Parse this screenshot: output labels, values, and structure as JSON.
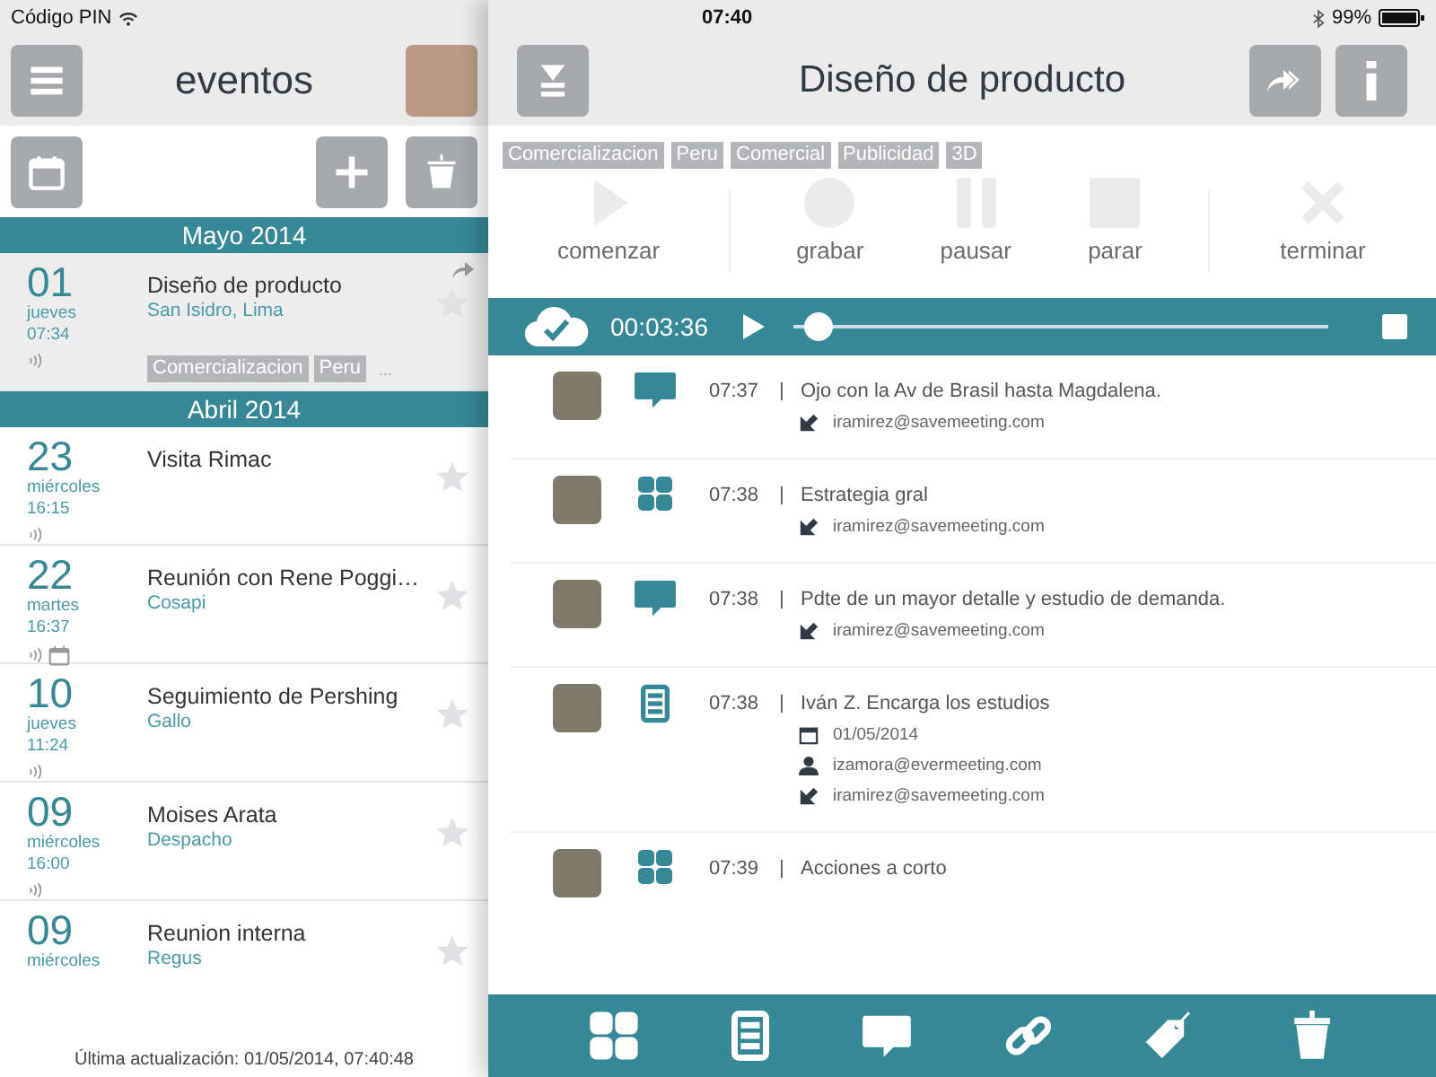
{
  "status_bar": {
    "carrier": "Código PIN",
    "time": "07:40",
    "battery": "99%"
  },
  "sidebar": {
    "title": "eventos",
    "sections": [
      {
        "month": "Mayo 2014",
        "events": [
          {
            "day": "01",
            "weekday": "jueves",
            "time": "07:34",
            "title": "Diseño de producto",
            "place": "San Isidro, Lima",
            "selected": true,
            "audio": true,
            "calendar": false,
            "shared": true,
            "tags": [
              "Comercializacion",
              "Peru"
            ],
            "more": "..."
          }
        ]
      },
      {
        "month": "Abril 2014",
        "events": [
          {
            "day": "23",
            "weekday": "miércoles",
            "time": "16:15",
            "title": "Visita Rimac",
            "selected": false,
            "audio": true,
            "calendar": false,
            "shared": false
          },
          {
            "day": "22",
            "weekday": "martes",
            "time": "16:37",
            "title": "Reunión con Rene Poggi…",
            "place": "Cosapi",
            "selected": false,
            "audio": true,
            "calendar": true,
            "shared": false
          },
          {
            "day": "10",
            "weekday": "jueves",
            "time": "11:24",
            "title": "Seguimiento de Pershing",
            "place": "Gallo",
            "selected": false,
            "audio": true,
            "calendar": false,
            "shared": false
          },
          {
            "day": "09",
            "weekday": "miércoles",
            "time": "16:00",
            "title": "Moises Arata",
            "place": "Despacho",
            "selected": false,
            "audio": true,
            "calendar": false,
            "shared": false
          },
          {
            "day": "09",
            "weekday": "miércoles",
            "title": "Reunion interna",
            "place": "Regus",
            "selected": false,
            "audio": false,
            "calendar": false,
            "shared": false
          }
        ]
      }
    ],
    "footer": "Última actualización: 01/05/2014, 07:40:48"
  },
  "detail": {
    "title": "Diseño de producto",
    "tags": [
      "Comercializacion",
      "Peru",
      "Comercial",
      "Publicidad",
      "3D"
    ],
    "control_groups": [
      [
        {
          "label": "comenzar",
          "kind": "play",
          "disabled": true
        }
      ],
      [
        {
          "label": "grabar",
          "kind": "record",
          "disabled": true
        },
        {
          "label": "pausar",
          "kind": "pause",
          "disabled": true
        },
        {
          "label": "parar",
          "kind": "stop",
          "disabled": true
        }
      ],
      [
        {
          "label": "terminar",
          "kind": "end",
          "disabled": true
        }
      ]
    ],
    "player": {
      "elapsed": "00:03:36",
      "level": 0.02
    },
    "entries": [
      {
        "kind": "comment",
        "time": "07:37",
        "text": "Ojo con la Av de Brasil hasta Magdalena.",
        "meta": [
          {
            "kind": "assignee",
            "text": "iramirez@savemeeting.com"
          }
        ]
      },
      {
        "kind": "topic",
        "time": "07:38",
        "text": "Estrategia gral",
        "meta": [
          {
            "kind": "assignee",
            "text": "iramirez@savemeeting.com"
          }
        ]
      },
      {
        "kind": "comment",
        "time": "07:38",
        "text": "Pdte de un mayor detalle y estudio de demanda.",
        "meta": [
          {
            "kind": "assignee",
            "text": "iramirez@savemeeting.com"
          }
        ]
      },
      {
        "kind": "task",
        "time": "07:38",
        "text": "Iván Z. Encarga los estudios",
        "meta": [
          {
            "kind": "date",
            "text": "01/05/2014"
          },
          {
            "kind": "person",
            "text": "izamora@evermeeting.com"
          },
          {
            "kind": "assignee",
            "text": "iramirez@savemeeting.com"
          }
        ]
      },
      {
        "kind": "topic",
        "time": "07:39",
        "text": "Acciones a corto"
      }
    ]
  }
}
